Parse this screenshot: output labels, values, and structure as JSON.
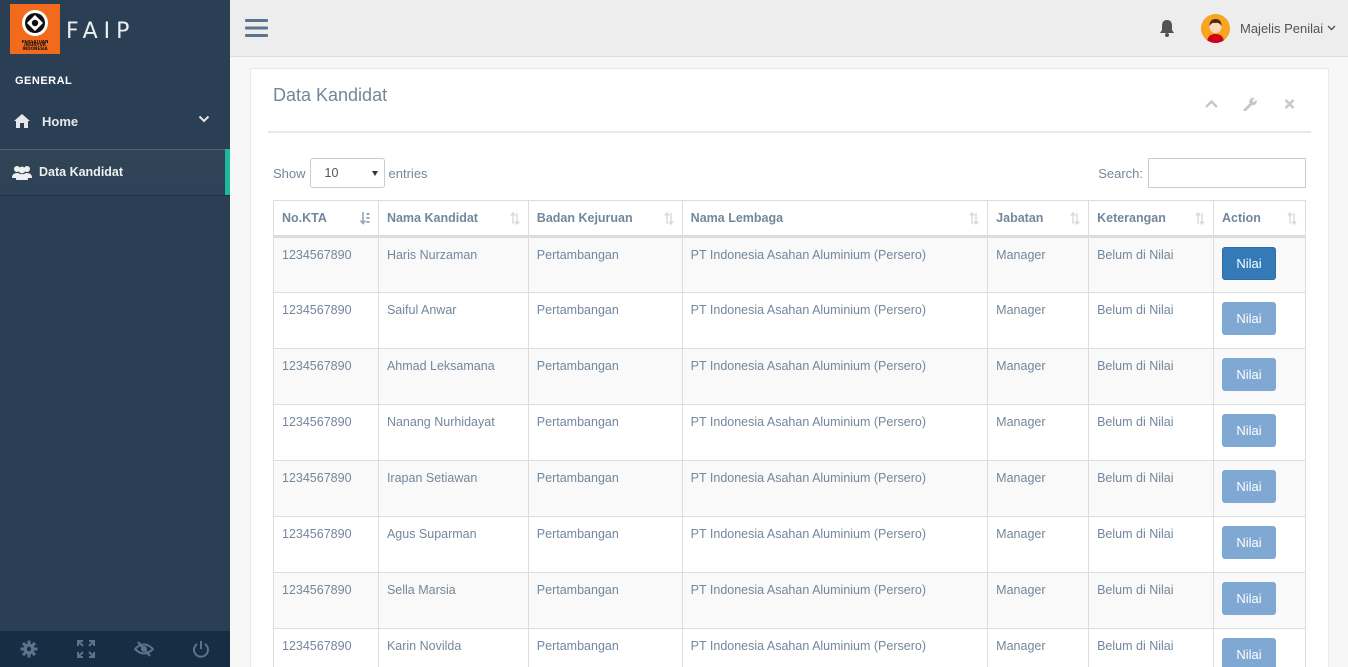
{
  "brand": {
    "name": "FAIP",
    "logo_text": "PERSATUAN INSINYUR INDONESIA",
    "accent_color": "#F26B1D"
  },
  "sidebar": {
    "section": "GENERAL",
    "items": [
      {
        "label": "Home",
        "icon": "home-icon"
      },
      {
        "label": "Data Kandidat",
        "icon": "users-icon"
      }
    ],
    "active_color": "#1ABB9C",
    "footer_icons": [
      "gear-icon",
      "fullscreen-icon",
      "eye-slash-icon",
      "power-icon"
    ]
  },
  "topnav": {
    "user_name": "Majelis Penilai",
    "icons": [
      "menu-toggle-icon",
      "bell-icon",
      "avatar",
      "chevron-down-icon"
    ]
  },
  "panel": {
    "title": "Data Kandidat",
    "tools": [
      "chevron-up-icon",
      "wrench-icon",
      "close-icon"
    ],
    "show_label": "Show",
    "entries_label": "entries",
    "page_length": "10",
    "search_label": "Search:",
    "search_value": ""
  },
  "table": {
    "columns": [
      "No.KTA",
      "Nama Kandidat",
      "Badan Kejuruan",
      "Nama Lembaga",
      "Jabatan",
      "Keterangan",
      "Action"
    ],
    "rows": [
      {
        "kta": "1234567890",
        "nama": "Haris Nurzaman",
        "badan": "Pertambangan",
        "lembaga": "PT Indonesia Asahan Aluminium (Persero)",
        "jabatan": "Manager",
        "keterangan": "Belum di Nilai",
        "action": "Nilai"
      },
      {
        "kta": "1234567890",
        "nama": "Saiful Anwar",
        "badan": "Pertambangan",
        "lembaga": "PT Indonesia Asahan Aluminium (Persero)",
        "jabatan": "Manager",
        "keterangan": "Belum di Nilai",
        "action": "Nilai"
      },
      {
        "kta": "1234567890",
        "nama": "Ahmad Leksamana",
        "badan": "Pertambangan",
        "lembaga": "PT Indonesia Asahan Aluminium (Persero)",
        "jabatan": "Manager",
        "keterangan": "Belum di Nilai",
        "action": "Nilai"
      },
      {
        "kta": "1234567890",
        "nama": "Nanang Nurhidayat",
        "badan": "Pertambangan",
        "lembaga": "PT Indonesia Asahan Aluminium (Persero)",
        "jabatan": "Manager",
        "keterangan": "Belum di Nilai",
        "action": "Nilai"
      },
      {
        "kta": "1234567890",
        "nama": "Irapan Setiawan",
        "badan": "Pertambangan",
        "lembaga": "PT Indonesia Asahan Aluminium (Persero)",
        "jabatan": "Manager",
        "keterangan": "Belum di Nilai",
        "action": "Nilai"
      },
      {
        "kta": "1234567890",
        "nama": "Agus Suparman",
        "badan": "Pertambangan",
        "lembaga": "PT Indonesia Asahan Aluminium (Persero)",
        "jabatan": "Manager",
        "keterangan": "Belum di Nilai",
        "action": "Nilai"
      },
      {
        "kta": "1234567890",
        "nama": "Sella Marsia",
        "badan": "Pertambangan",
        "lembaga": "PT Indonesia Asahan Aluminium (Persero)",
        "jabatan": "Manager",
        "keterangan": "Belum di Nilai",
        "action": "Nilai"
      },
      {
        "kta": "1234567890",
        "nama": "Karin Novilda",
        "badan": "Pertambangan",
        "lembaga": "PT Indonesia Asahan Aluminium (Persero)",
        "jabatan": "Manager",
        "keterangan": "Belum di Nilai",
        "action": "Nilai"
      }
    ],
    "button_color": "#337AB7"
  }
}
